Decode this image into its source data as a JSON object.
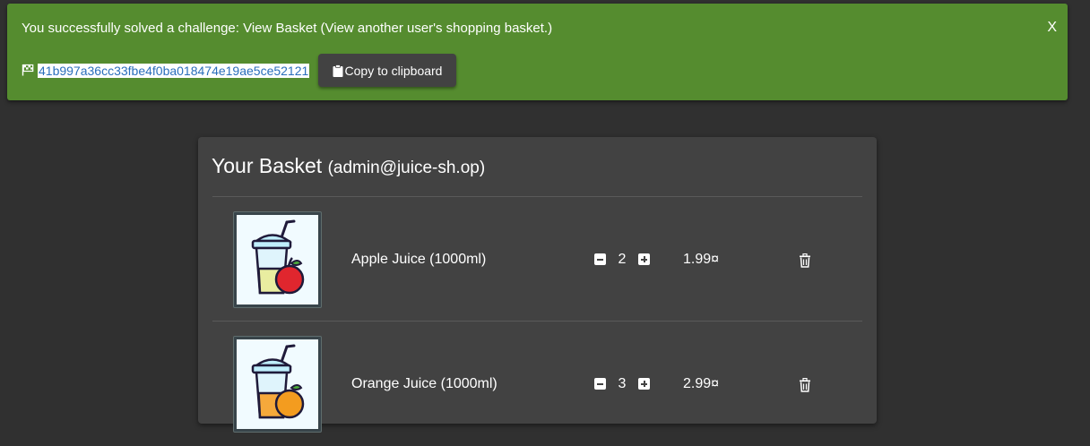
{
  "notification": {
    "message": "You successfully solved a challenge: View Basket (View another user's shopping basket.)",
    "close_label": "X",
    "flag_code": "41b997a36cc33fbe4f0ba018474e19ae5ce52121",
    "copy_label": "Copy to clipboard",
    "banner_color": "#558c2f"
  },
  "basket": {
    "title": "Your Basket",
    "user": "(admin@juice-sh.op)",
    "items": [
      {
        "name": "Apple Juice (1000ml)",
        "quantity": "2",
        "price": "1.99¤",
        "fruit": "apple-icon"
      },
      {
        "name": "Orange Juice (1000ml)",
        "quantity": "3",
        "price": "2.99¤",
        "fruit": "orange-icon"
      }
    ]
  }
}
